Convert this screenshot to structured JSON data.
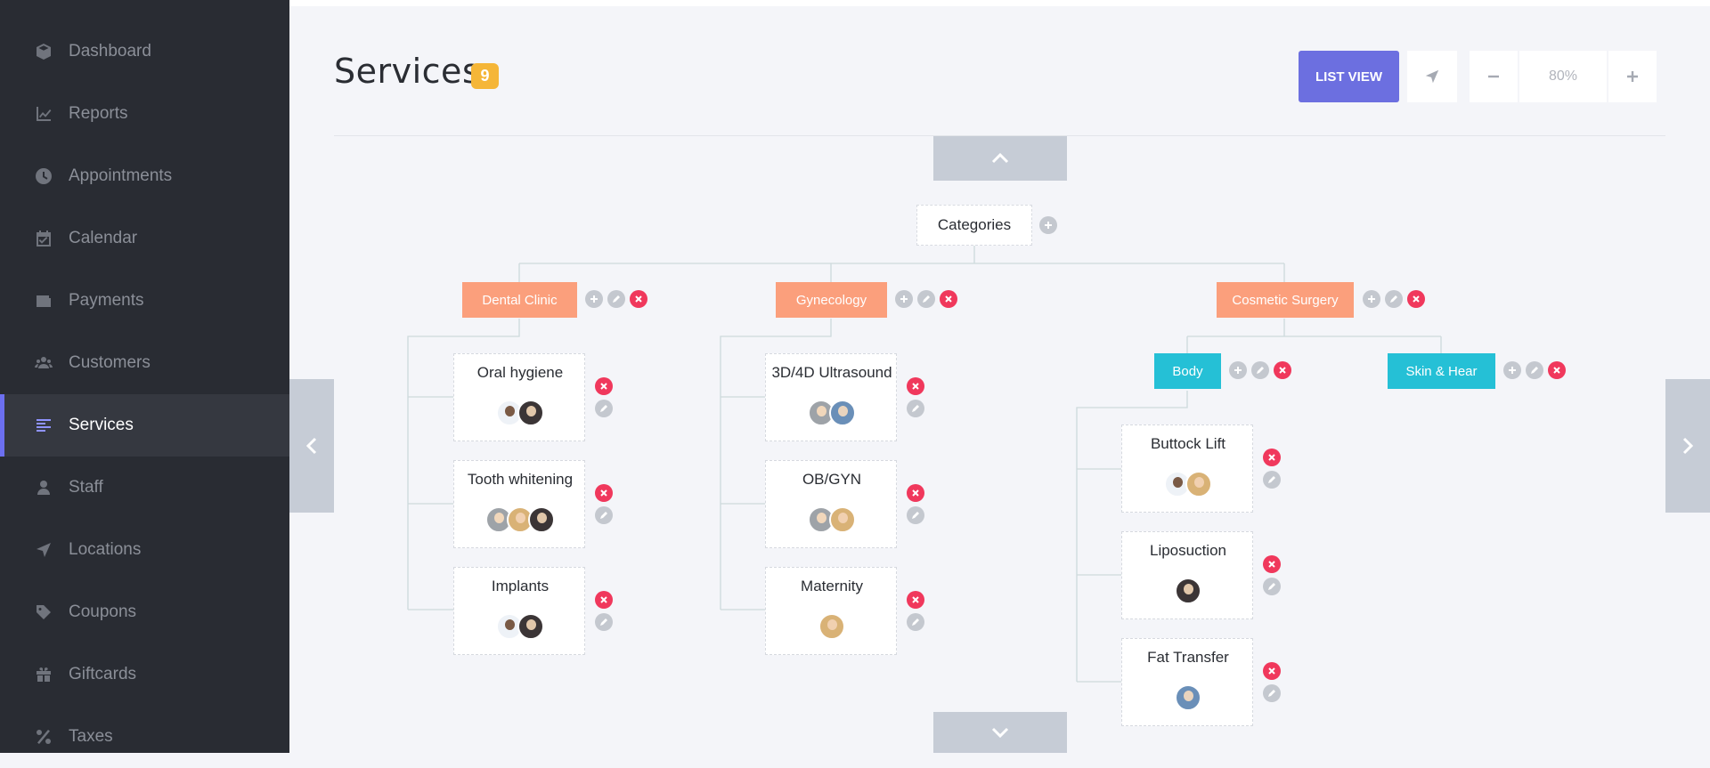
{
  "sidebar": {
    "items": [
      {
        "label": "Dashboard",
        "icon": "cube-icon",
        "active": false
      },
      {
        "label": "Reports",
        "icon": "chart-icon",
        "active": false
      },
      {
        "label": "Appointments",
        "icon": "clock-icon",
        "active": false
      },
      {
        "label": "Calendar",
        "icon": "calendar-icon",
        "active": false
      },
      {
        "label": "Payments",
        "icon": "wallet-icon",
        "active": false
      },
      {
        "label": "Customers",
        "icon": "users-icon",
        "active": false
      },
      {
        "label": "Services",
        "icon": "list-icon",
        "active": true
      },
      {
        "label": "Staff",
        "icon": "user-icon",
        "active": false
      },
      {
        "label": "Locations",
        "icon": "location-arrow-icon",
        "active": false
      },
      {
        "label": "Coupons",
        "icon": "tag-icon",
        "active": false
      },
      {
        "label": "Giftcards",
        "icon": "gift-icon",
        "active": false
      },
      {
        "label": "Taxes",
        "icon": "percent-icon",
        "active": false
      }
    ]
  },
  "header": {
    "title": "Services",
    "count": "9",
    "list_view_label": "LIST VIEW",
    "zoom": "80%"
  },
  "tree": {
    "root": "Categories",
    "categories": [
      {
        "label": "Dental Clinic"
      },
      {
        "label": "Gynecology"
      },
      {
        "label": "Cosmetic Surgery"
      }
    ],
    "subcategories": [
      {
        "label": "Body"
      },
      {
        "label": "Skin & Hear"
      }
    ],
    "services": [
      {
        "title": "Oral hygiene"
      },
      {
        "title": "Tooth whitening"
      },
      {
        "title": "Implants"
      },
      {
        "title": "3D/4D Ultrasound"
      },
      {
        "title": "OB/GYN"
      },
      {
        "title": "Maternity"
      },
      {
        "title": "Buttock Lift"
      },
      {
        "title": "Liposuction"
      },
      {
        "title": "Fat Transfer"
      }
    ]
  },
  "colors": {
    "sidebar_bg": "#292c33",
    "accent": "#6c6fe0",
    "badge": "#f5b638",
    "category": "#fb9f7c",
    "subcategory": "#25c0d6",
    "delete": "#f0385c"
  }
}
